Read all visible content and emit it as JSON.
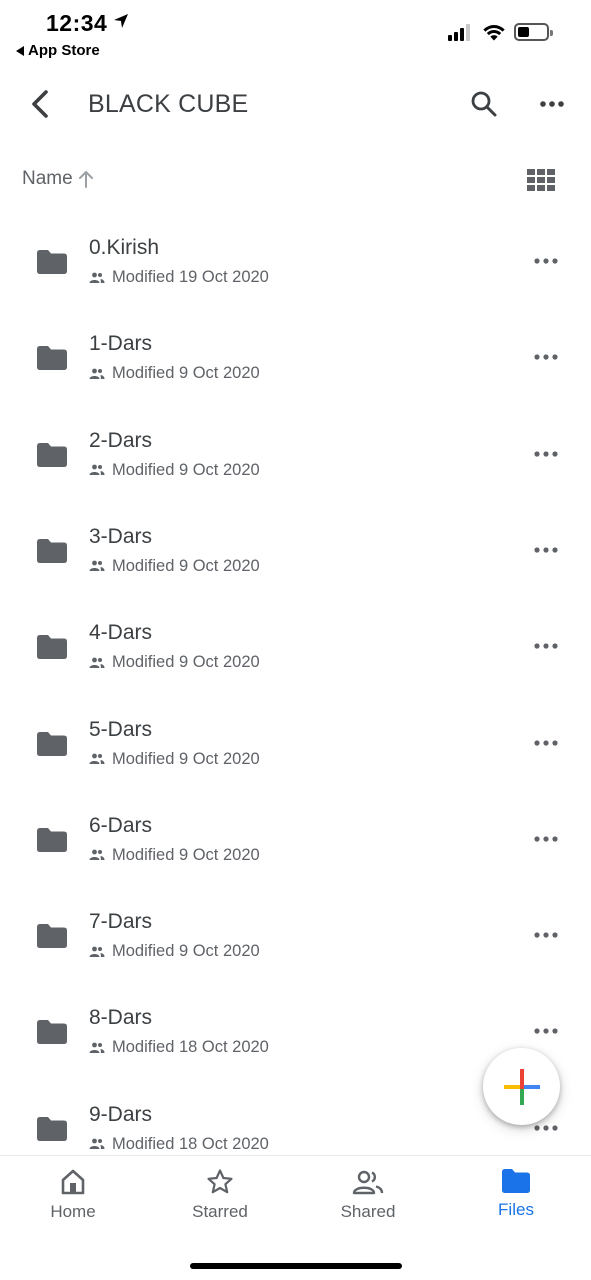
{
  "status_bar": {
    "time": "12:34",
    "back_app": "App Store"
  },
  "app_bar": {
    "title": "BLACK CUBE",
    "back_icon": "back-arrow-icon",
    "search_icon": "search-icon",
    "more_icon": "more-horizontal-icon"
  },
  "sort": {
    "label": "Name",
    "direction_icon": "arrow-up-icon",
    "view_toggle_icon": "grid-view-icon"
  },
  "files": [
    {
      "name": "0.Kirish",
      "meta": "Modified 19 Oct 2020"
    },
    {
      "name": "1-Dars",
      "meta": "Modified 9 Oct 2020"
    },
    {
      "name": "2-Dars",
      "meta": "Modified 9 Oct 2020"
    },
    {
      "name": "3-Dars",
      "meta": "Modified 9 Oct 2020"
    },
    {
      "name": "4-Dars",
      "meta": "Modified 9 Oct 2020"
    },
    {
      "name": "5-Dars",
      "meta": "Modified 9 Oct 2020"
    },
    {
      "name": "6-Dars",
      "meta": "Modified 9 Oct 2020"
    },
    {
      "name": "7-Dars",
      "meta": "Modified 9 Oct 2020"
    },
    {
      "name": "8-Dars",
      "meta": "Modified 18 Oct 2020"
    },
    {
      "name": "9-Dars",
      "meta": "Modified 18 Oct 2020"
    }
  ],
  "fab": {
    "icon": "add-plus-icon"
  },
  "bottom_nav": {
    "items": [
      {
        "label": "Home",
        "icon": "home-icon",
        "active": false
      },
      {
        "label": "Starred",
        "icon": "star-icon",
        "active": false
      },
      {
        "label": "Shared",
        "icon": "shared-people-icon",
        "active": false
      },
      {
        "label": "Files",
        "icon": "folder-icon",
        "active": true
      }
    ]
  },
  "colors": {
    "text_primary": "#3c4043",
    "text_secondary": "#5f6368",
    "folder": "#5f6368",
    "accent_blue": "#1a73e8",
    "google_red": "#ea4335",
    "google_yellow": "#fbbc04",
    "google_green": "#34a853",
    "google_blue": "#4285f4"
  }
}
